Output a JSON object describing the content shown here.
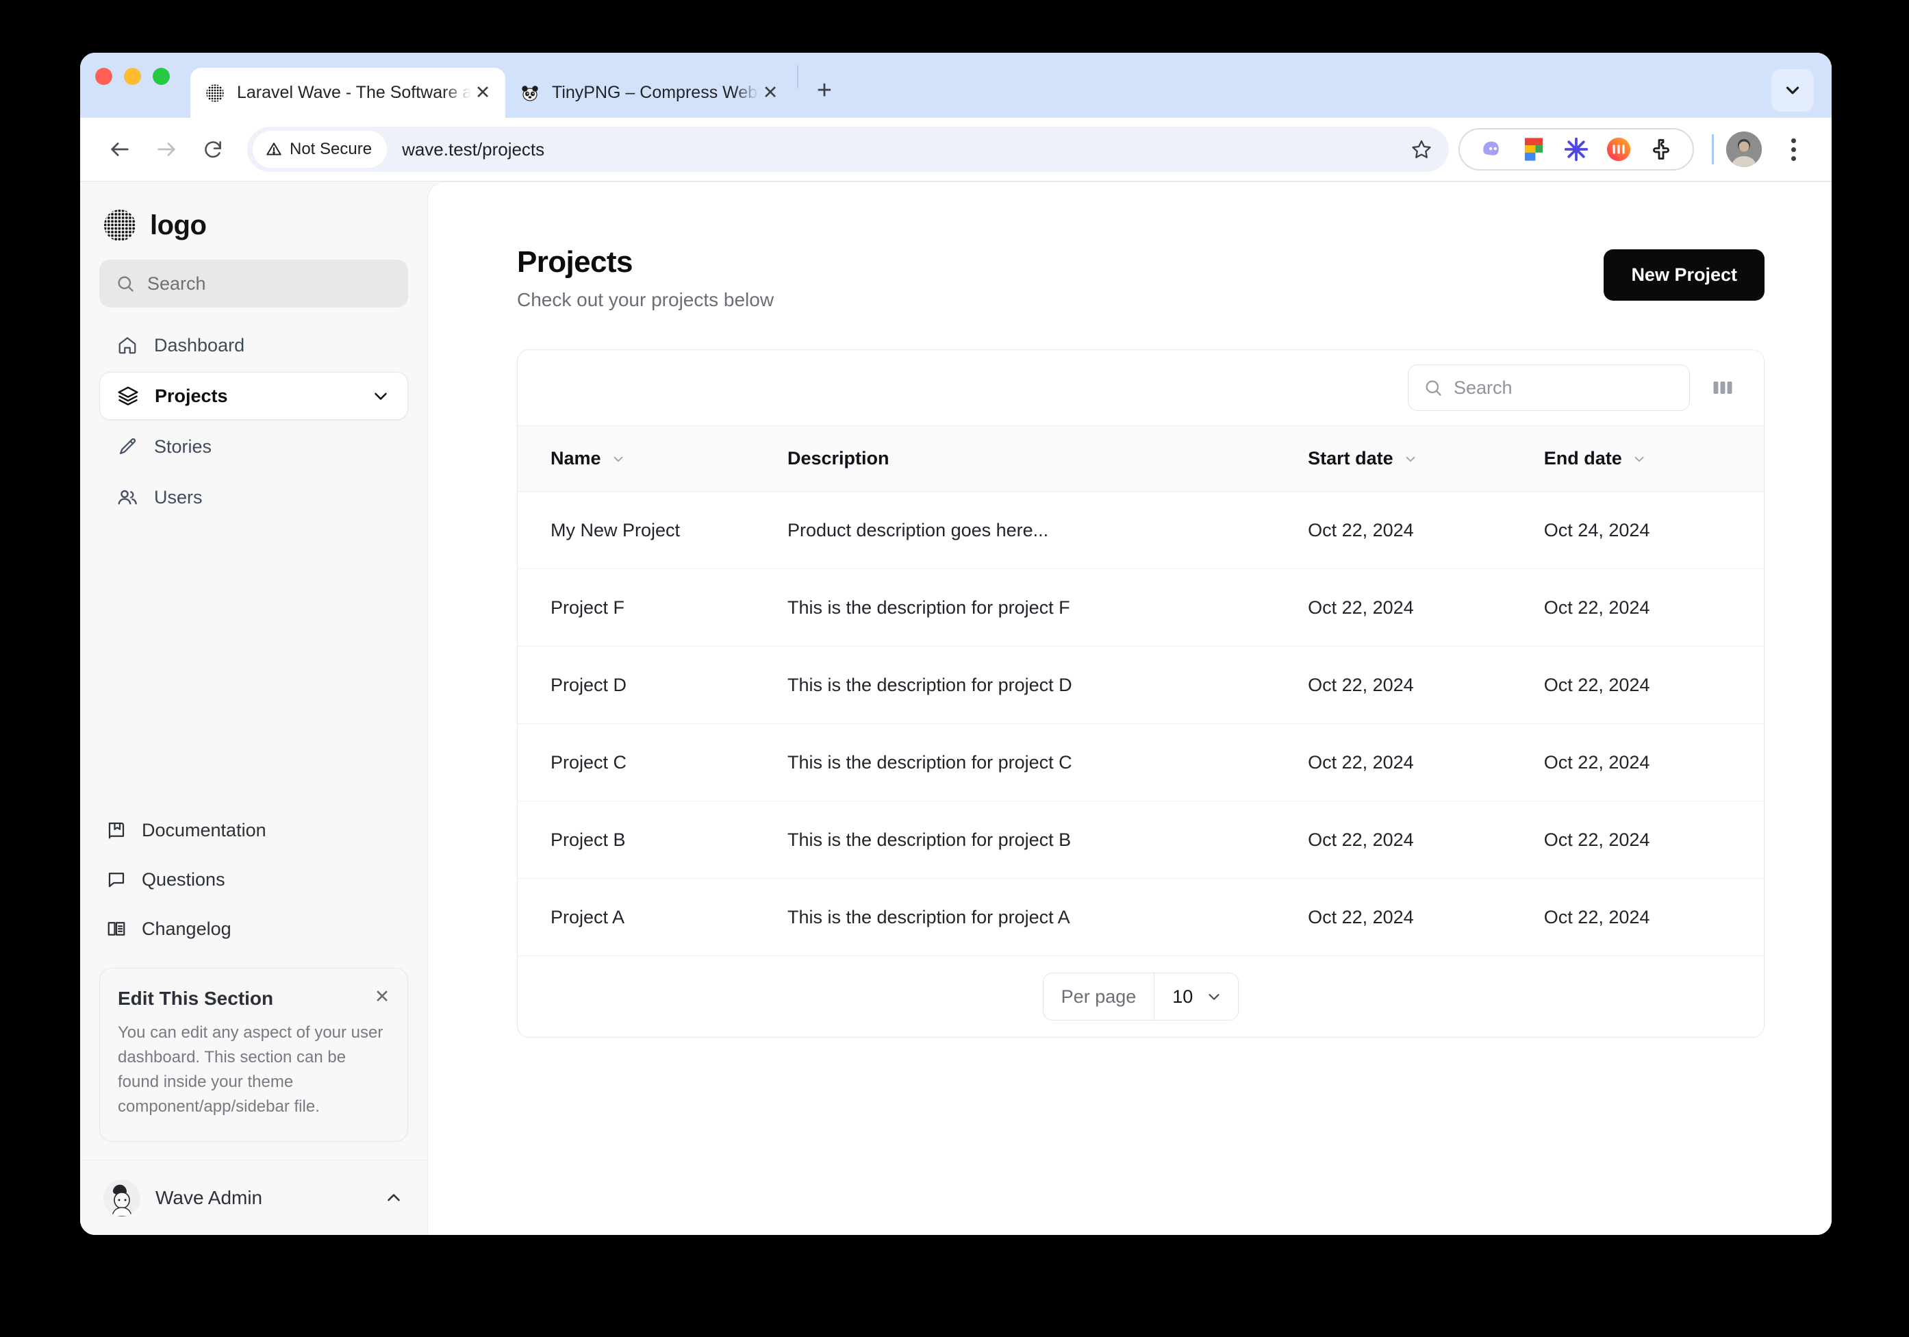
{
  "browser": {
    "tabs": [
      {
        "title": "Laravel Wave - The Software a",
        "favicon": "wave-logo-favicon",
        "active": true,
        "close_label": "✕"
      },
      {
        "title": "TinyPNG – Compress WebP, P",
        "favicon": "tinypng-panda-favicon",
        "active": false,
        "close_label": "✕"
      }
    ],
    "new_tab_label": "+",
    "address": {
      "security_label": "Not Secure",
      "url": "wave.test/projects"
    },
    "extensions": [
      "ghost-icon",
      "figma-icon",
      "asterisk-icon",
      "gradient-m-icon",
      "puzzle-piece-icon"
    ],
    "accent_blue": "#d3e2fb",
    "omnibox_bg": "#eef1f9"
  },
  "sidebar": {
    "brand": {
      "name": "logo",
      "logo": "dotted-sphere-logo"
    },
    "search": {
      "placeholder": "Search",
      "icon": "search-icon"
    },
    "nav": [
      {
        "label": "Dashboard",
        "icon": "home-icon",
        "active": false
      },
      {
        "label": "Projects",
        "icon": "layers-icon",
        "active": true,
        "chevron": "chevron-down-icon"
      },
      {
        "label": "Stories",
        "icon": "pencil-icon",
        "active": false
      },
      {
        "label": "Users",
        "icon": "users-icon",
        "active": false
      }
    ],
    "bottom_nav": [
      {
        "label": "Documentation",
        "icon": "book-bookmark-icon"
      },
      {
        "label": "Questions",
        "icon": "chat-bubble-icon"
      },
      {
        "label": "Changelog",
        "icon": "open-book-icon"
      }
    ],
    "edit_card": {
      "title": "Edit This Section",
      "body": "You can edit any aspect of your user dashboard. This section can be found inside your theme component/app/sidebar file.",
      "close_label": "✕"
    },
    "user": {
      "name": "Wave Admin",
      "avatar": "user-avatar",
      "chevron": "chevron-up-icon"
    }
  },
  "main": {
    "title": "Projects",
    "subtitle": "Check out your projects below",
    "new_project_label": "New Project",
    "table": {
      "search_placeholder": "Search",
      "columns_icon": "columns-toggle-icon",
      "headers": [
        {
          "label": "Name",
          "sortable": true
        },
        {
          "label": "Description",
          "sortable": false
        },
        {
          "label": "Start date",
          "sortable": true
        },
        {
          "label": "End date",
          "sortable": true
        }
      ],
      "rows": [
        {
          "name": "My New Project",
          "description": "Product description goes here...",
          "start": "Oct 22, 2024",
          "end": "Oct 24, 2024"
        },
        {
          "name": "Project F",
          "description": "This is the description for project F",
          "start": "Oct 22, 2024",
          "end": "Oct 22, 2024"
        },
        {
          "name": "Project D",
          "description": "This is the description for project D",
          "start": "Oct 22, 2024",
          "end": "Oct 22, 2024"
        },
        {
          "name": "Project C",
          "description": "This is the description for project C",
          "start": "Oct 22, 2024",
          "end": "Oct 22, 2024"
        },
        {
          "name": "Project B",
          "description": "This is the description for project B",
          "start": "Oct 22, 2024",
          "end": "Oct 22, 2024"
        },
        {
          "name": "Project A",
          "description": "This is the description for project A",
          "start": "Oct 22, 2024",
          "end": "Oct 22, 2024"
        }
      ],
      "footer": {
        "per_page_label": "Per page",
        "per_page_value": "10",
        "chevron": "chevron-down-icon"
      }
    }
  }
}
